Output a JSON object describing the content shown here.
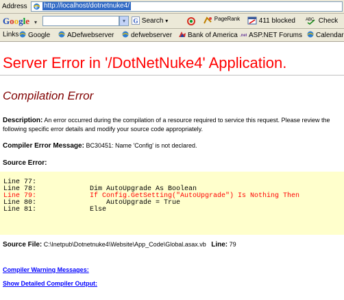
{
  "browser": {
    "address_label": "Address",
    "url": "http://localhost/dotnetnuke4/"
  },
  "google_toolbar": {
    "logo_letters": [
      "G",
      "o",
      "o",
      "g",
      "l",
      "e"
    ],
    "logo_dropdown": "▾",
    "search_label": "Search",
    "pagerank_label": "PageRank",
    "blocked_label": "411 blocked",
    "check_label": "Check"
  },
  "links_bar": {
    "label": "Links",
    "items": [
      "Google",
      "ADefwebserver",
      "defwebserver",
      "Bank of America",
      "ASP.NET Forums",
      "Calendar"
    ]
  },
  "page": {
    "title": "Server Error in '/DotNetNuke4' Application.",
    "subtitle": "Compilation Error",
    "description_label": "Description:",
    "description_text": " An error occurred during the compilation of a resource required to service this request. Please review the following specific error details and modify your source code appropriately.",
    "compiler_msg_label": "Compiler Error Message:",
    "compiler_msg_text": " BC30451: Name 'Config' is not declared.",
    "source_error_label": "Source Error:",
    "code_lines": [
      {
        "num": "Line 77:",
        "code": ""
      },
      {
        "num": "Line 78:",
        "code": "Dim AutoUpgrade As Boolean"
      },
      {
        "num": "Line 79:",
        "code": "If Config.GetSetting(\"AutoUpgrade\") Is Nothing Then"
      },
      {
        "num": "Line 80:",
        "code": "    AutoUpgrade = True"
      },
      {
        "num": "Line 81:",
        "code": "Else"
      }
    ],
    "source_file_label": "Source File:",
    "source_file_path": " C:\\Inetpub\\Dotnetnuke4\\Website\\App_Code\\Global.asax.vb",
    "line_label": "Line:",
    "line_number": " 79",
    "warning_link": "Compiler Warning Messages:",
    "detail_link": "Show Detailed Compiler Output:"
  }
}
